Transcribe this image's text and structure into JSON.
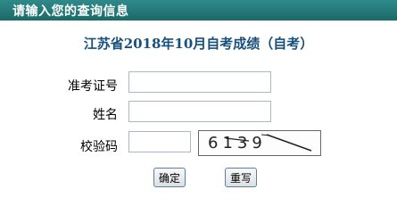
{
  "header": {
    "title": "请输入您的查询信息"
  },
  "form": {
    "title": "江苏省2018年10月自考成绩（自考）",
    "exam_number_label": "准考证号",
    "exam_number_value": "",
    "name_label": "姓名",
    "name_value": "",
    "captcha_label": "校验码",
    "captcha_value": "",
    "captcha_text": "6139",
    "confirm_label": "确定",
    "reset_label": "重写"
  }
}
